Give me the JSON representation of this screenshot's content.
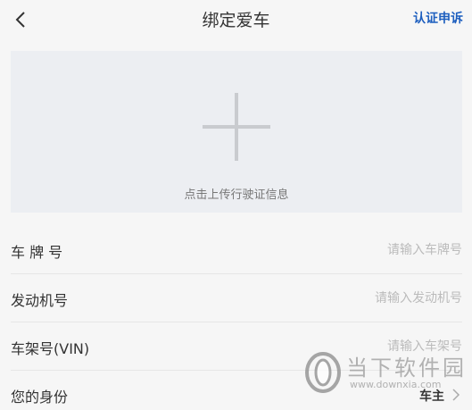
{
  "header": {
    "title": "绑定爱车",
    "appeal_label": "认证申诉"
  },
  "upload": {
    "hint": "点击上传行驶证信息"
  },
  "form": {
    "plate": {
      "label": "车 牌 号",
      "placeholder": "请输入车牌号",
      "value": ""
    },
    "engine": {
      "label": "发动机号",
      "placeholder": "请输入发动机号",
      "value": ""
    },
    "vin": {
      "label": "车架号(VIN)",
      "placeholder": "请输入车架号",
      "value": ""
    },
    "identity": {
      "label": "您的身份",
      "value": "车主"
    }
  },
  "watermark": {
    "name": "当下软件园",
    "url": "www.downxia.com"
  },
  "icons": {
    "back": "back-arrow-icon",
    "plus": "plus-icon",
    "chevron": "chevron-right-icon"
  },
  "colors": {
    "accent": "#1e5fbf",
    "upload_bg": "#eceef2",
    "page_bg": "#f6f6f6"
  }
}
